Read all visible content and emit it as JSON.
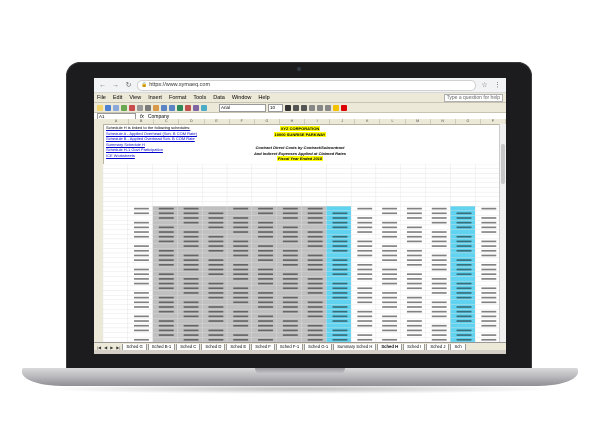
{
  "browser": {
    "url": "https://www.symaeq.com"
  },
  "menu": {
    "items": [
      "File",
      "Edit",
      "View",
      "Insert",
      "Format",
      "Tools",
      "Data",
      "Window",
      "Help"
    ],
    "help_placeholder": "Type a question for help"
  },
  "toolbar": {
    "font_name": "Arial",
    "font_size": "10"
  },
  "formula_bar": {
    "cell_ref": "A1",
    "content": "Company"
  },
  "sheet": {
    "columns": [
      "A",
      "B",
      "C",
      "D",
      "E",
      "F",
      "G",
      "H",
      "I",
      "J",
      "K",
      "L",
      "M",
      "N",
      "O",
      "P"
    ],
    "links": [
      "Schedule H is linked to the following schedules:",
      "Schedule A - Applied Overhead (Sch. B COM Rate)",
      "Schedule B - Applied Overhead Sch. B COM Rate",
      "Summary Schedule H",
      "Schedule H-1 Govt Participation",
      "ICE Worksheets"
    ],
    "company": "XYZ CORPORATION",
    "address": "10000 SUNRISE PARKWAY",
    "title_line1": "Contract Direct Costs by Contract/Subcontract",
    "title_line2": "And Indirect Expenses Applied at Claimed Rates",
    "title_line3": "Fiscal Year Ended 2018"
  },
  "grid_colors": {
    "gray": "#c0c0c0",
    "cyan": "#5fd3ef",
    "text": "#1a1a1a"
  },
  "tabs": [
    "Sched G",
    "Sched B-1",
    "Sched C",
    "Sched D",
    "Sched E",
    "Sched F",
    "Sched F-1",
    "Sched G-1",
    "Summary Sched H",
    "Sched H",
    "Sched I",
    "Sched J",
    "Sch"
  ],
  "active_tab": "Sched H"
}
